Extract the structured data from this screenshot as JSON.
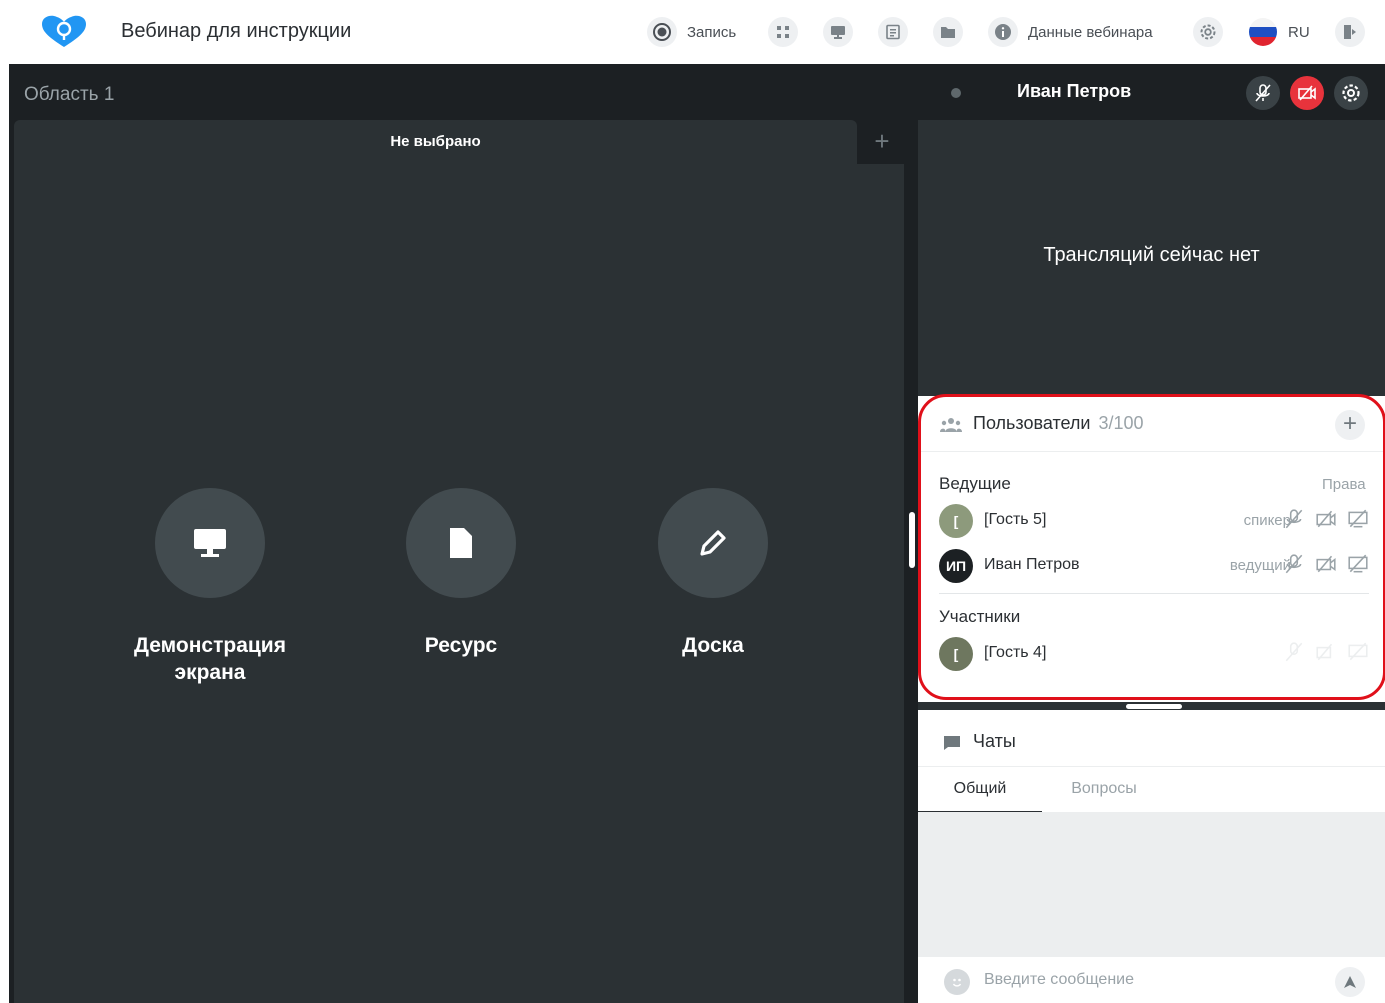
{
  "header": {
    "title": "Вебинар для инструкции",
    "record_label": "Запись",
    "webinar_data_label": "Данные вебинара",
    "language": "RU",
    "brand_color": "#2196f3"
  },
  "workspace": {
    "area_title": "Область 1",
    "tab_label": "Не выбрано",
    "add_tab": "+",
    "options": [
      {
        "label": "Демонстрация экрана",
        "icon": "monitor-icon"
      },
      {
        "label": "Ресурс",
        "icon": "file-icon"
      },
      {
        "label": "Доска",
        "icon": "pencil-icon"
      }
    ]
  },
  "video": {
    "name": "Иван Петров",
    "status": "Трансляций сейчас нет",
    "camera_off_color": "#e8333c"
  },
  "users": {
    "title": "Пользователи",
    "count": "3/100",
    "add": "+",
    "rights_label": "Права",
    "hosts_title": "Ведущие",
    "participants_title": "Участники",
    "hosts": [
      {
        "initials": "[",
        "name": "[Гость 5]",
        "role": "спикер",
        "avatar_color": "#8d9a7c"
      },
      {
        "initials": "ИП",
        "name": "Иван Петров",
        "role": "ведущий",
        "avatar_color": "#1c2023"
      }
    ],
    "participants": [
      {
        "initials": "[",
        "name": "[Гость 4]",
        "role": "",
        "avatar_color": "#6e775f"
      }
    ]
  },
  "chat": {
    "title": "Чаты",
    "tabs": [
      "Общий",
      "Вопросы"
    ],
    "active_tab": "Общий",
    "placeholder": "Введите сообщение"
  }
}
